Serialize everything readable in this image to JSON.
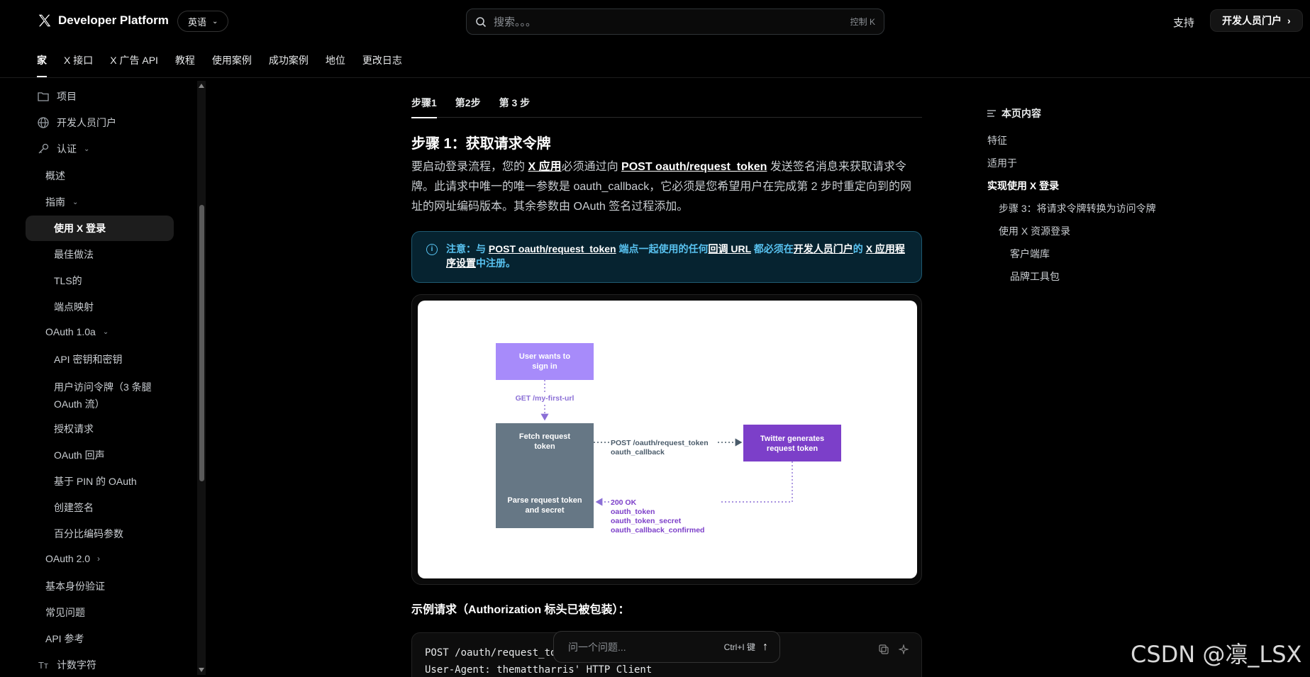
{
  "header": {
    "brand": "Developer Platform",
    "language": "英语",
    "search_placeholder": "搜索。。。",
    "search_shortcut": "控制 K",
    "support": "支持",
    "portal": "开发人员门户"
  },
  "nav": {
    "items": [
      "家",
      "X 接口",
      "X 广告 API",
      "教程",
      "使用案例",
      "成功案例",
      "地位",
      "更改日志"
    ]
  },
  "sidebar": {
    "items": [
      {
        "label": "项目",
        "icon": "folder-icon"
      },
      {
        "label": "开发人员门户",
        "icon": "globe-icon"
      },
      {
        "label": "认证",
        "icon": "key-icon"
      },
      {
        "label": "概述"
      },
      {
        "label": "指南"
      },
      {
        "label": "使用 X 登录"
      },
      {
        "label": "最佳做法"
      },
      {
        "label": "TLS的"
      },
      {
        "label": "端点映射"
      },
      {
        "label": "OAuth 1.0a"
      },
      {
        "label": "API 密钥和密钥"
      },
      {
        "label": "用户访问令牌（3 条腿"
      },
      {
        "label": "OAuth 流）"
      },
      {
        "label": "授权请求"
      },
      {
        "label": "OAuth 回声"
      },
      {
        "label": "基于 PIN 的 OAuth"
      },
      {
        "label": "创建签名"
      },
      {
        "label": "百分比编码参数"
      },
      {
        "label": "OAuth 2.0"
      },
      {
        "label": "基本身份验证"
      },
      {
        "label": "常见问题"
      },
      {
        "label": "API 参考"
      },
      {
        "label": "计数字符",
        "icon": "text-size-icon"
      }
    ]
  },
  "main": {
    "tabs": [
      "步骤1",
      "第2步",
      "第 3 步"
    ],
    "heading": "步骤 1：获取请求令牌",
    "para": {
      "p1": "要启动登录流程，您的 ",
      "link1": "X 应用",
      "p2": "必须通过向 ",
      "link2": "POST oauth/request_token",
      "p3": " 发送签名消息来获取请求令牌。此请求中唯一的唯一参数是 oauth_callback，它必须是您希望用户在完成第 2 步时重定向到的网址的网址编码版本。其余参数由 OAuth 签名过程添加。"
    },
    "note": {
      "label": "注意：",
      "t1": "与 ",
      "link1": "POST oauth/request_token",
      "t2": " 端点一起使用的任何",
      "link2": "回调 URL",
      "t3": " 都必须在",
      "link3": "开发人员门户",
      "t4": "的 ",
      "link4": "X 应用程序设置",
      "t5": "中注册。"
    },
    "diagram": {
      "box1": [
        "User wants to",
        "sign in"
      ],
      "arrow1": "GET /my-first-url",
      "box2": [
        "Fetch request",
        "token"
      ],
      "box3": [
        "Parse request token",
        "and secret"
      ],
      "arrow2": [
        "POST /oauth/request_token",
        "oauth_callback"
      ],
      "box4": [
        "Twitter generates",
        "request token"
      ],
      "arrow3": [
        "200 OK",
        "oauth_token",
        "oauth_token_secret",
        "oauth_callback_confirmed"
      ]
    },
    "example_heading": "示例请求（Authorization 标头已被包装）：",
    "code": {
      "line1": "POST /oauth/request_to",
      "line2": "User-Agent: themattharris' HTTP Client"
    },
    "ask": {
      "placeholder": "问一个问题...",
      "shortcut": "Ctrl+I 键"
    }
  },
  "toc": {
    "title": "本页内容",
    "items": [
      "特征",
      "适用于",
      "实现使用 X 登录",
      "步骤 3：将请求令牌转换为访问令牌",
      "使用 X 资源登录",
      "客户端库",
      "品牌工具包"
    ]
  },
  "watermark": "CSDN @凛_LSX"
}
